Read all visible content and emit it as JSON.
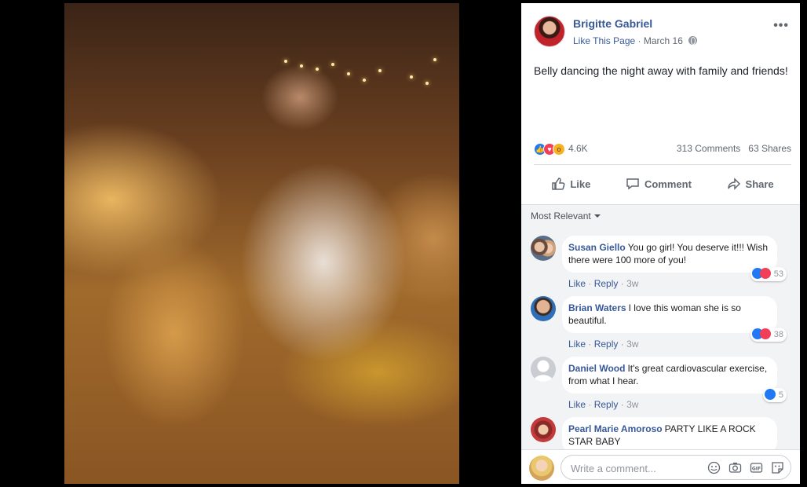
{
  "post": {
    "page_name": "Brigitte Gabriel",
    "like_page": "Like This Page",
    "separator": "·",
    "date": "March 16",
    "text": "Belly dancing the night away with family and friends!",
    "more": "•••"
  },
  "stats": {
    "reaction_count": "4.6K",
    "comments": "313 Comments",
    "shares": "63 Shares"
  },
  "actions": {
    "like": "Like",
    "comment": "Comment",
    "share": "Share"
  },
  "comments_sort": "Most Relevant",
  "comments": [
    {
      "author": "Susan Giello",
      "text": "You go girl! You deserve it!!! Wish there were 100 more of you!",
      "like": "Like",
      "reply": "Reply",
      "time": "3w",
      "reactions": "53",
      "sep": "·"
    },
    {
      "author": "Brian Waters",
      "text": "I love this woman she is so beautiful.",
      "like": "Like",
      "reply": "Reply",
      "time": "3w",
      "reactions": "38",
      "sep": "·"
    },
    {
      "author": "Daniel Wood",
      "text": "It's great cardiovascular exercise, from what I hear.",
      "like": "Like",
      "reply": "Reply",
      "time": "3w",
      "reactions": "5",
      "sep": "·"
    },
    {
      "author": "Pearl Marie Amoroso",
      "text": "PARTY LIKE A ROCK STAR BABY"
    }
  ],
  "composer": {
    "placeholder": "Write a comment..."
  },
  "colors": {
    "link": "#385898",
    "like_blue": "#2078f4",
    "love_red": "#f33e58",
    "wow_yellow": "#f7b125"
  }
}
